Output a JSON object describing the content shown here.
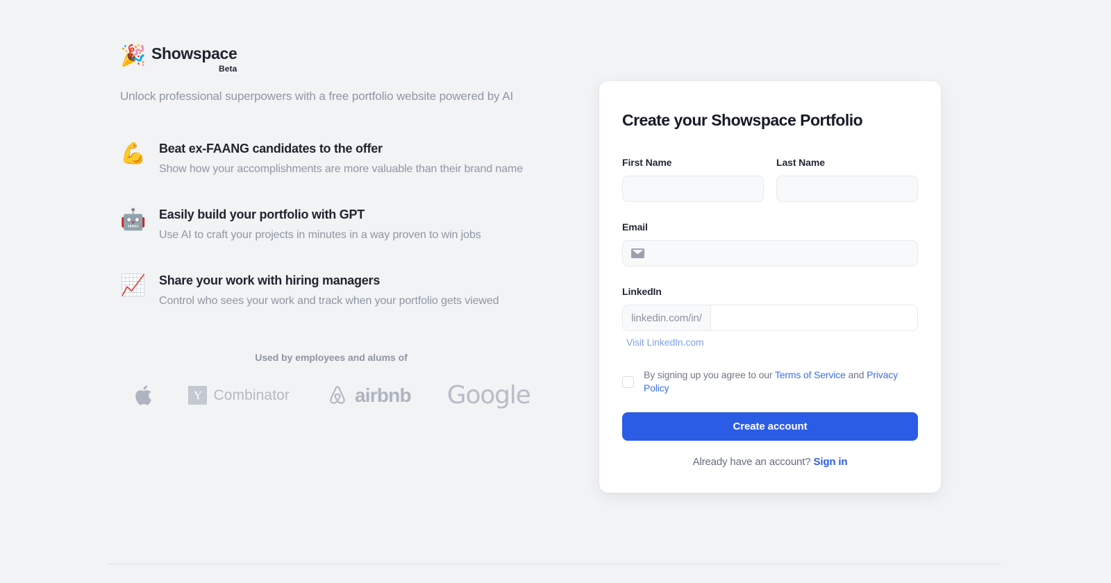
{
  "brand": {
    "emoji": "🎉",
    "emoji_name": "party-popper-icon",
    "name": "Showspace",
    "badge": "Beta",
    "tagline": "Unlock professional superpowers with a free portfolio website powered by AI"
  },
  "features": [
    {
      "icon": "💪",
      "icon_name": "flexed-biceps-icon",
      "title": "Beat ex-FAANG candidates to the offer",
      "description": "Show how your accomplishments are more valuable than their brand name"
    },
    {
      "icon": "🤖",
      "icon_name": "robot-icon",
      "title": "Easily build your portfolio with GPT",
      "description": "Use AI to craft your projects in minutes in a way proven to win jobs"
    },
    {
      "icon": "📈",
      "icon_name": "chart-increasing-icon",
      "title": "Share your work with hiring managers",
      "description": "Control who sees your work and track when your portfolio gets viewed"
    }
  ],
  "social_proof": {
    "title": "Used by employees and alums of",
    "logos": [
      {
        "name": "apple-logo",
        "label": "Apple"
      },
      {
        "name": "ycombinator-logo",
        "badge": "Y",
        "label": "Combinator"
      },
      {
        "name": "airbnb-logo",
        "label": "airbnb"
      },
      {
        "name": "google-logo",
        "label": "Google"
      }
    ]
  },
  "signup": {
    "title": "Create your Showspace Portfolio",
    "first_name": {
      "label": "First Name",
      "value": "",
      "placeholder": ""
    },
    "last_name": {
      "label": "Last Name",
      "value": "",
      "placeholder": ""
    },
    "email": {
      "label": "Email",
      "value": "",
      "placeholder": "",
      "icon": "envelope-icon"
    },
    "linkedin": {
      "label": "LinkedIn",
      "prefix": "linkedin.com/in/",
      "value": "",
      "placeholder": "",
      "helper_link": "Visit LinkedIn.com"
    },
    "terms": {
      "checked": false,
      "prefix": "By signing up you agree to our ",
      "terms_link": "Terms of Service",
      "conjunction": " and ",
      "privacy_link": "Privacy Policy"
    },
    "submit_label": "Create account",
    "signin_prompt": "Already have an account?",
    "signin_link": "Sign in"
  },
  "colors": {
    "page_background": "#F1F3F5",
    "card_background": "#FFFFFF",
    "accent": "#2B5CE6",
    "link": "#3B6FE8",
    "muted_text": "#8E96A3",
    "heading_text": "#20242E",
    "logo_gray": "#B4BAC4"
  }
}
